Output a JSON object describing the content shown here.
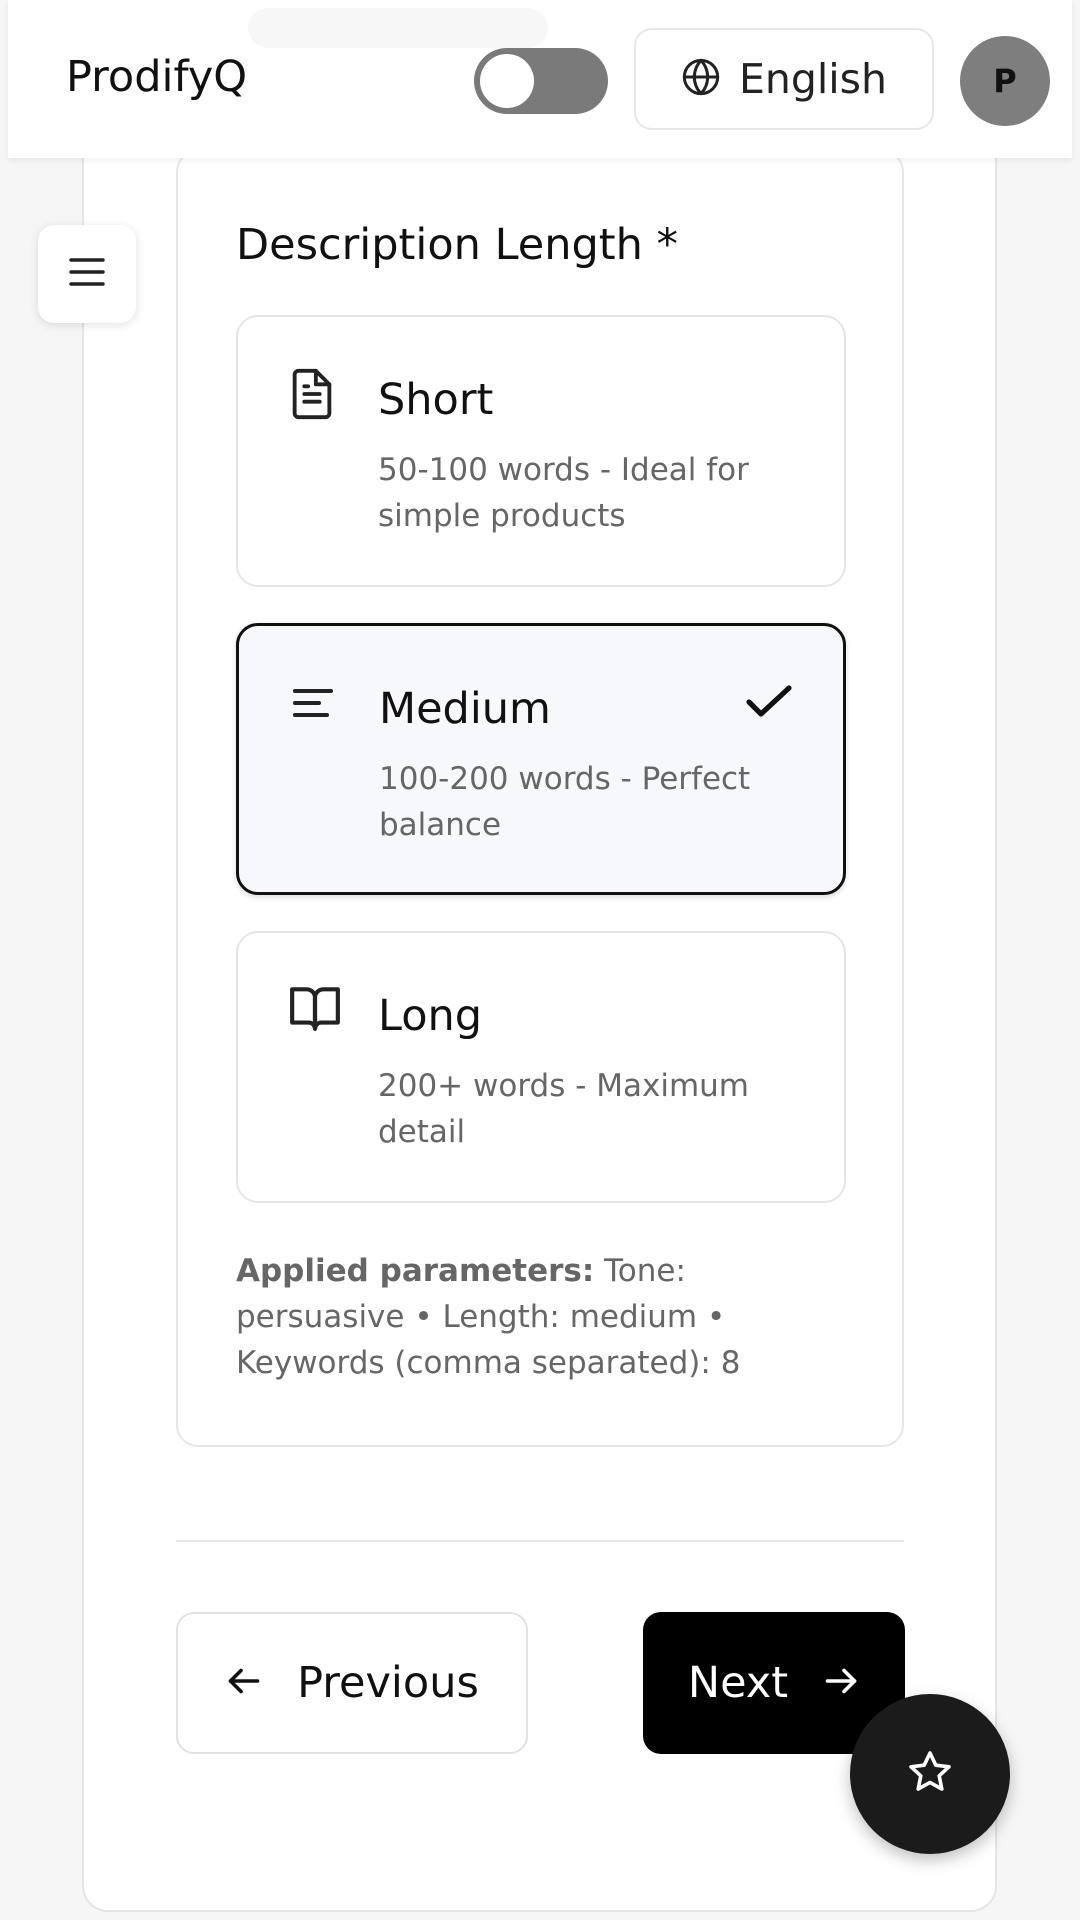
{
  "header": {
    "app_title": "ProdifyQ",
    "language_label": "English",
    "avatar_initial": "P",
    "toggle_state": "off"
  },
  "form": {
    "section_title": "Description Length *",
    "options": [
      {
        "title": "Short",
        "description": "50-100 words - Ideal for simple products",
        "icon": "document-icon",
        "selected": false
      },
      {
        "title": "Medium",
        "description": "100-200 words - Perfect balance",
        "icon": "align-left-icon",
        "selected": true
      },
      {
        "title": "Long",
        "description": "200+ words - Maximum detail",
        "icon": "open-book-icon",
        "selected": false
      }
    ],
    "applied_label": "Applied parameters:",
    "applied_text": " Tone: persuasive • Length: medium • Keywords (comma separated): 8"
  },
  "navigation": {
    "previous_label": "Previous",
    "next_label": "Next"
  },
  "colors": {
    "primary": "#000000",
    "selected_bg": "#f6f8fb",
    "muted_text": "#666666"
  }
}
